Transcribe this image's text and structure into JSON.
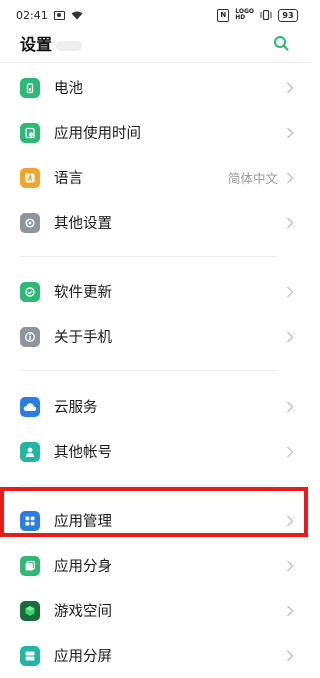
{
  "status_bar": {
    "time": "02:41",
    "battery": "93",
    "logo_line1": "LOGO",
    "logo_line2": "HD"
  },
  "header": {
    "title": "设置"
  },
  "items": [
    {
      "label": "电池",
      "icon": "battery-icon",
      "color": "#2fb874"
    },
    {
      "label": "应用使用时间",
      "icon": "app-usage-icon",
      "color": "#2fb874"
    },
    {
      "label": "语言",
      "icon": "language-icon",
      "color": "#f1a52c",
      "value": "简体中文"
    },
    {
      "label": "其他设置",
      "icon": "other-settings-icon",
      "color": "#8f959d"
    },
    {
      "label": "软件更新",
      "icon": "software-update-icon",
      "color": "#2fb874"
    },
    {
      "label": "关于手机",
      "icon": "about-phone-icon",
      "color": "#8f959d"
    },
    {
      "label": "云服务",
      "icon": "cloud-icon",
      "color": "#2a7de1"
    },
    {
      "label": "其他帐号",
      "icon": "accounts-icon",
      "color": "#22b5a6"
    },
    {
      "label": "应用管理",
      "icon": "app-management-icon",
      "color": "#2a7de1"
    },
    {
      "label": "应用分身",
      "icon": "app-clone-icon",
      "color": "#2fb874"
    },
    {
      "label": "游戏空间",
      "icon": "game-space-icon",
      "color": "#1c6b3c"
    },
    {
      "label": "应用分屏",
      "icon": "split-screen-icon",
      "color": "#22b5a6"
    }
  ],
  "colors": {
    "accent": "#2fb874",
    "highlight": "#e81a1a"
  }
}
